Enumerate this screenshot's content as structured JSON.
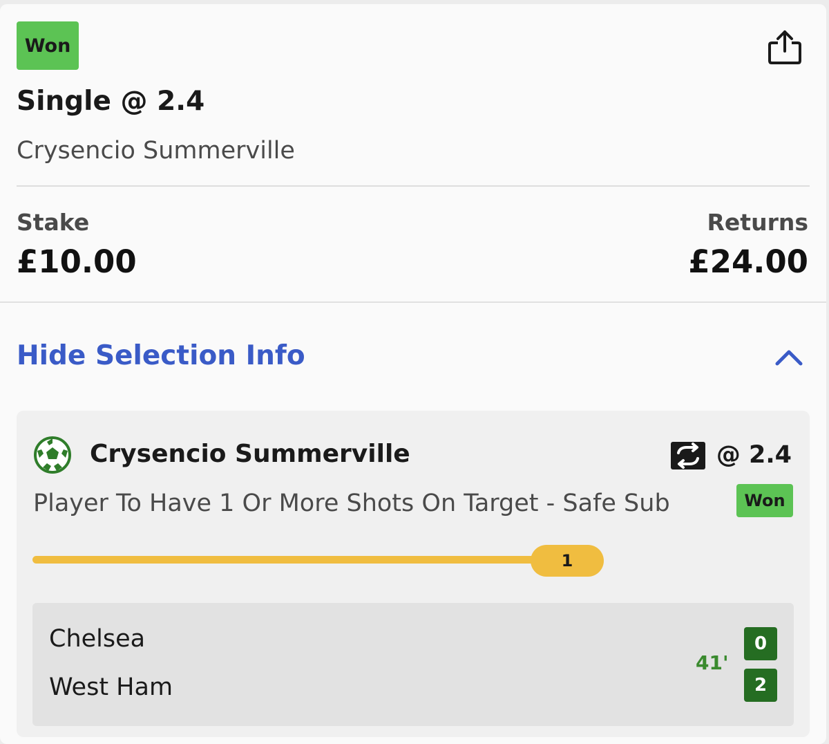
{
  "bet": {
    "status": "Won",
    "title": "Single @ 2.4",
    "subtitle": "Crysencio Summerville",
    "stake_label": "Stake",
    "stake_value": "£10.00",
    "returns_label": "Returns",
    "returns_value": "£24.00"
  },
  "toggle": {
    "label": "Hide Selection Info"
  },
  "selection": {
    "name": "Crysencio Summerville",
    "odds": "@ 2.4",
    "market": "Player To Have 1 Or More Shots On Target - Safe Sub",
    "status": "Won",
    "progress_value": "1",
    "progress_fraction": 1.0
  },
  "match": {
    "home_team": "Chelsea",
    "away_team": "West Ham",
    "time": "41'",
    "home_score": "0",
    "away_score": "2"
  },
  "icons": {
    "share": "share-icon",
    "chevron": "chevron-up-icon",
    "sport": "football-icon",
    "swap": "swap-icon"
  },
  "colors": {
    "won_badge": "#5cc354",
    "link_blue": "#3a5bc7",
    "progress_yellow": "#f0bd40",
    "score_green": "#256d22",
    "time_green": "#3a8a2e"
  }
}
